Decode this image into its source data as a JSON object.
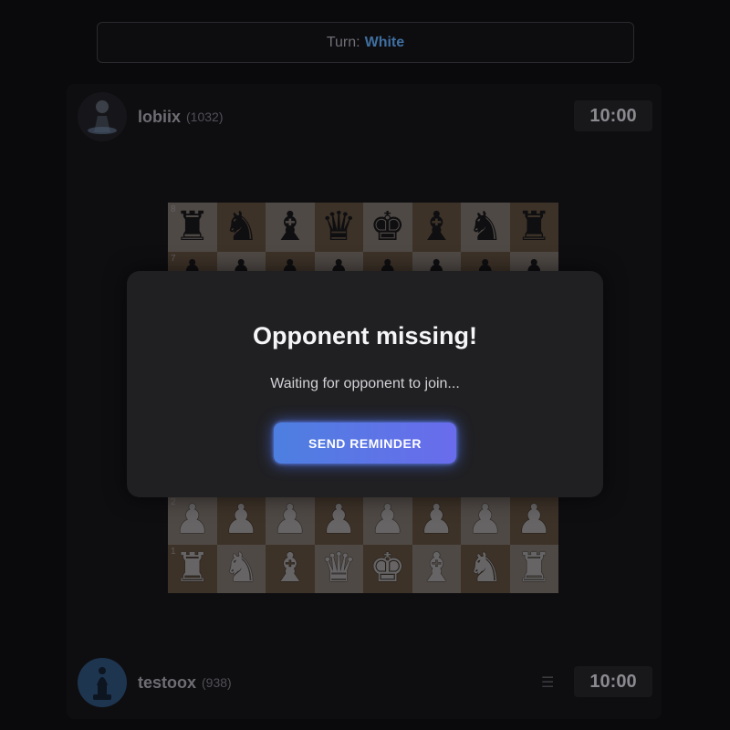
{
  "turn": {
    "label": "Turn:",
    "value": "White"
  },
  "opponent": {
    "name": "lobiix",
    "rating": "(1032)",
    "clock": "10:00"
  },
  "player": {
    "name": "testoox",
    "rating": "(938)",
    "clock": "10:00"
  },
  "board": {
    "rank_labels": {
      "8": "8",
      "7": "7",
      "2": "2",
      "1": "1"
    },
    "rows": [
      [
        "br",
        "bn",
        "bb",
        "bq",
        "bk",
        "bb",
        "bn",
        "br"
      ],
      [
        "bp",
        "bp",
        "bp",
        "bp",
        "bp",
        "bp",
        "bp",
        "bp"
      ],
      [
        "",
        "",
        "",
        "",
        "",
        "",
        "",
        ""
      ],
      [
        "",
        "",
        "",
        "",
        "",
        "",
        "",
        ""
      ],
      [
        "",
        "",
        "",
        "",
        "",
        "",
        "",
        ""
      ],
      [
        "",
        "",
        "",
        "",
        "",
        "",
        "",
        ""
      ],
      [
        "wp",
        "wp",
        "wp",
        "wp",
        "wp",
        "wp",
        "wp",
        "wp"
      ],
      [
        "wr",
        "wn",
        "wb",
        "wq",
        "wk",
        "wb",
        "wn",
        "wr"
      ]
    ]
  },
  "modal": {
    "title": "Opponent missing!",
    "subtitle": "Waiting for opponent to join...",
    "button": "SEND REMINDER"
  },
  "colors": {
    "accent": "#5577e6",
    "turn_value": "#3f6fa0"
  },
  "icons": {
    "menu": "hamburger-icon",
    "avatar_top": "chess-pawn-avatar-icon",
    "avatar_bottom": "chess-bishop-avatar-icon"
  }
}
